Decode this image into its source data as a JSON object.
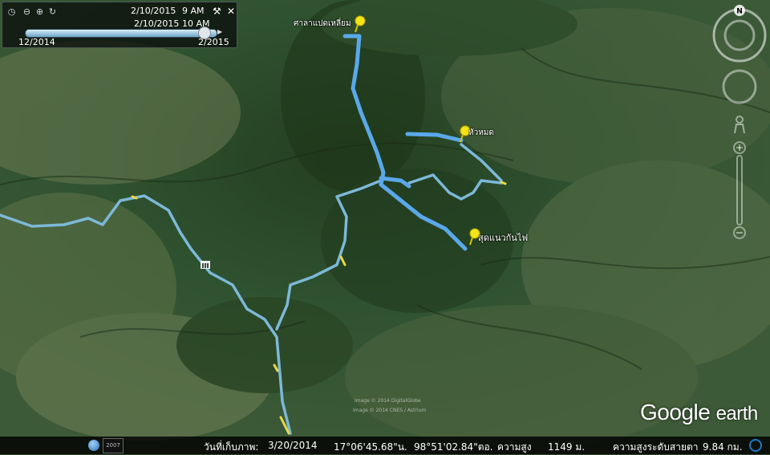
{
  "timeslider": {
    "start_time_date": "2/10/2015",
    "start_time_hour": "9 AM",
    "end_time_date": "2/10/2015",
    "end_time_hour": "10 AM",
    "range_start": "12/2014",
    "range_end": "2/2015"
  },
  "placemarks": [
    {
      "label": "ศาลาแปดเหลี่ยม"
    },
    {
      "label": "หัวหมด"
    },
    {
      "label": "สุดแนวกันไฟ"
    }
  ],
  "compass": {
    "north": "N"
  },
  "copyright_lines": [
    "Image © 2014 DigitalGlobe",
    "Image © 2014 CNES / Astrium"
  ],
  "logo": {
    "brand": "Google",
    "product": "earth"
  },
  "status": {
    "imagery_date_label": "วันที่เก็บภาพ:",
    "imagery_date": "3/20/2014",
    "lat": "17°06'45.68\"น.",
    "lon": "98°51'02.84\"ตอ.",
    "elevation_label": "ความสูง",
    "elevation": "1149 ม.",
    "eye_alt_label": "ความสูงระดับสายตา",
    "eye_alt": "9.84 กม.",
    "mini_badge": "2007"
  },
  "colors": {
    "route": "#6fb3e0",
    "route_bright": "#5aa8ea",
    "pin": "#f5e416",
    "highlight": "#e9d94a"
  }
}
